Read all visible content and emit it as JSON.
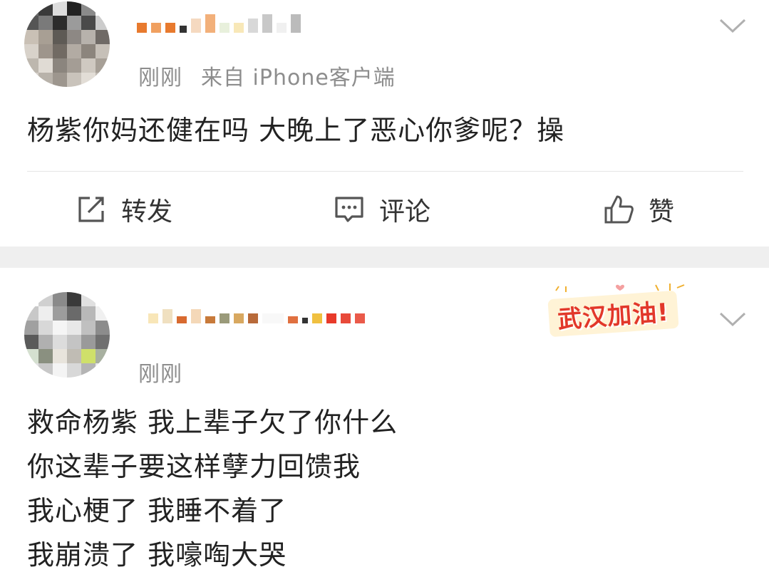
{
  "posts": [
    {
      "time": "刚刚",
      "source": "来自 iPhone客户端",
      "body_lines": [
        "杨紫你妈还健在吗 大晚上了恶心你爹呢？操"
      ],
      "actions": {
        "repost": "转发",
        "comment": "评论",
        "like": "赞"
      }
    },
    {
      "time": "刚刚",
      "badge": "武汉加油!",
      "body_lines": [
        "救命杨紫 我上辈子欠了你什么",
        "你这辈子要这样孽力回馈我",
        "我心梗了 我睡不着了",
        "我崩溃了 我嚎啕大哭"
      ]
    }
  ],
  "colors": {
    "meta": "#8d8d8d",
    "badge": "#e2372a",
    "separator": "#efefef"
  },
  "icons": [
    "repost-icon",
    "comment-icon",
    "like-icon",
    "chevron-down-icon"
  ]
}
